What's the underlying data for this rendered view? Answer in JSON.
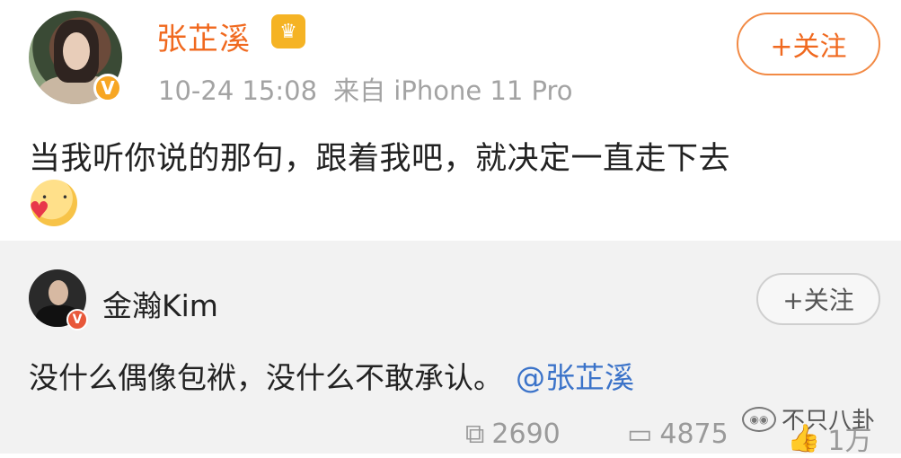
{
  "post": {
    "author": "张芷溪",
    "timestamp": "10-24 15:08",
    "source": "来自 iPhone 11 Pro",
    "follow_label": "+关注",
    "text": "当我听你说的那句，跟着我吧，就决定一直走下去",
    "icons": {
      "avatar": "user-avatar",
      "verified": "verified-v-icon",
      "crown": "crown-icon",
      "emoji": "blush-heart-emoji"
    }
  },
  "repost": {
    "author": "金瀚Kim",
    "follow_label": "+关注",
    "text": "没什么偶像包袱，没什么不敢承认。",
    "mention": "@张芷溪",
    "watermark": "不只八卦",
    "actions": {
      "repost_count": "2690",
      "comment_count": "4875",
      "like_count": "1万"
    }
  },
  "colors": {
    "author_name": "#f0691f",
    "follow_border": "#f28a45",
    "mention": "#3b73c9",
    "meta_gray": "#a3a3a3",
    "repost_bg": "#f2f2f2",
    "verified_badge": "#f7a623"
  }
}
